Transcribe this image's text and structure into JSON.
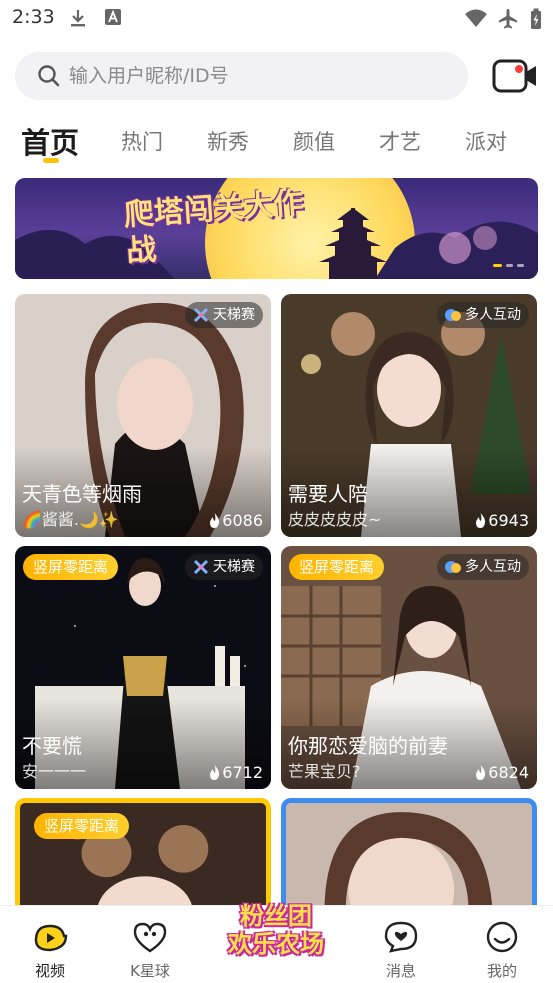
{
  "status_bar": {
    "time": "2:33"
  },
  "search": {
    "placeholder": "输入用户昵称/ID号"
  },
  "tabs": [
    {
      "label": "首页",
      "active": true
    },
    {
      "label": "热门"
    },
    {
      "label": "新秀"
    },
    {
      "label": "颜值"
    },
    {
      "label": "才艺"
    },
    {
      "label": "派对"
    }
  ],
  "banner": {
    "title": "爬塔闯关大作战",
    "slide_count": 3,
    "active_slide": 1
  },
  "cards": [
    {
      "title": "天青色等烟雨",
      "subtitle": "🌈酱酱.🌙✨",
      "heat": "6086",
      "badge_right": "天梯赛",
      "badge_left": ""
    },
    {
      "title": "需要人陪",
      "subtitle": "皮皮皮皮皮~",
      "heat": "6943",
      "badge_right": "多人互动",
      "badge_left": ""
    },
    {
      "title": "不要慌",
      "subtitle": "安一一一",
      "heat": "6712",
      "badge_right": "天梯赛",
      "badge_left": "竖屏零距离"
    },
    {
      "title": "你那恋爱脑的前妻",
      "subtitle": "芒果宝贝?",
      "heat": "6824",
      "badge_right": "多人互动",
      "badge_left": "竖屏零距离"
    },
    {
      "title": "",
      "subtitle": "",
      "heat": "",
      "badge_right": "",
      "badge_left": "竖屏零距离"
    },
    {
      "title": "",
      "subtitle": "",
      "heat": "",
      "badge_right": "",
      "badge_left": ""
    }
  ],
  "bottom_nav": {
    "items": [
      {
        "label": "视频",
        "icon": "video-icon",
        "active": true
      },
      {
        "label": "K星球",
        "icon": "heart-planet-icon"
      },
      {
        "label": "消息",
        "icon": "message-icon"
      },
      {
        "label": "我的",
        "icon": "profile-icon"
      }
    ],
    "promo": {
      "line1": "粉丝团",
      "line2": "欢乐农场"
    }
  },
  "colors": {
    "accent": "#ffc400",
    "badge_orange": "#ffb300",
    "frame_blue": "#3d8cf2"
  }
}
